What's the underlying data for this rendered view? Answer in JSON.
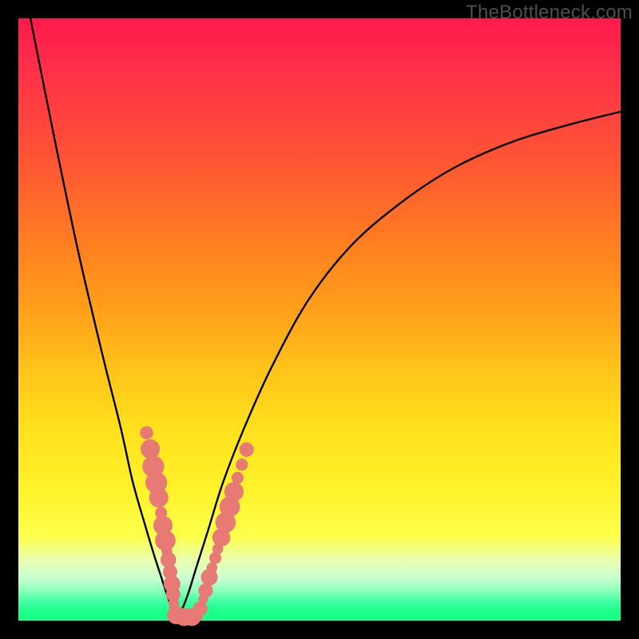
{
  "watermark": "TheBottleneck.com",
  "chart_data": {
    "type": "line",
    "title": "",
    "xlabel": "",
    "ylabel": "",
    "xlim": [
      0,
      100
    ],
    "ylim": [
      0,
      100
    ],
    "grid": false,
    "legend": false,
    "series": [
      {
        "name": "left-curve",
        "x": [
          2,
          6,
          10,
          14,
          17,
          19,
          21,
          22.5,
          23.8,
          24.6,
          25.2,
          25.6,
          25.9,
          26.1
        ],
        "y": [
          100,
          80,
          61,
          44,
          32,
          23,
          16,
          11,
          7,
          4.5,
          2.8,
          1.6,
          0.7,
          0.2
        ]
      },
      {
        "name": "right-curve",
        "x": [
          26.1,
          27,
          28.2,
          29.6,
          31.5,
          34,
          37.5,
          42,
          48,
          55,
          63,
          72,
          82,
          92,
          100
        ],
        "y": [
          0.2,
          1.5,
          4.5,
          9,
          15,
          23,
          32,
          42,
          53,
          62,
          69,
          75,
          79.5,
          82.5,
          84.5
        ]
      }
    ],
    "markers": {
      "name": "beads",
      "color": "#e77a74",
      "points": [
        {
          "x": 21.3,
          "y": 31.2,
          "r": 1.1
        },
        {
          "x": 21.9,
          "y": 28.5,
          "r": 1.6
        },
        {
          "x": 22.4,
          "y": 25.6,
          "r": 1.8
        },
        {
          "x": 22.9,
          "y": 22.9,
          "r": 1.8
        },
        {
          "x": 23.3,
          "y": 20.4,
          "r": 1.6
        },
        {
          "x": 23.7,
          "y": 17.9,
          "r": 1.0
        },
        {
          "x": 24.0,
          "y": 15.8,
          "r": 1.6
        },
        {
          "x": 24.4,
          "y": 13.3,
          "r": 1.7
        },
        {
          "x": 24.65,
          "y": 11.6,
          "r": 0.9
        },
        {
          "x": 24.9,
          "y": 10.1,
          "r": 1.3
        },
        {
          "x": 25.2,
          "y": 8.1,
          "r": 1.2
        },
        {
          "x": 25.5,
          "y": 6.1,
          "r": 1.4
        },
        {
          "x": 25.7,
          "y": 4.4,
          "r": 1.2
        },
        {
          "x": 25.8,
          "y": 2.9,
          "r": 0.9
        },
        {
          "x": 25.9,
          "y": 1.9,
          "r": 0.9
        },
        {
          "x": 26.2,
          "y": 0.9,
          "r": 1.5
        },
        {
          "x": 27.5,
          "y": 0.6,
          "r": 1.5
        },
        {
          "x": 28.8,
          "y": 0.6,
          "r": 1.5
        },
        {
          "x": 29.6,
          "y": 0.7,
          "r": 1.0
        },
        {
          "x": 30.2,
          "y": 2.0,
          "r": 1.2
        },
        {
          "x": 30.7,
          "y": 3.6,
          "r": 0.8
        },
        {
          "x": 31.1,
          "y": 5.0,
          "r": 1.2
        },
        {
          "x": 31.7,
          "y": 7.2,
          "r": 1.4
        },
        {
          "x": 32.15,
          "y": 8.8,
          "r": 0.9
        },
        {
          "x": 32.7,
          "y": 10.4,
          "r": 1.0
        },
        {
          "x": 33.1,
          "y": 11.9,
          "r": 0.9
        },
        {
          "x": 33.7,
          "y": 13.8,
          "r": 1.5
        },
        {
          "x": 34.4,
          "y": 16.3,
          "r": 1.7
        },
        {
          "x": 35.1,
          "y": 18.9,
          "r": 1.7
        },
        {
          "x": 35.8,
          "y": 21.4,
          "r": 1.6
        },
        {
          "x": 36.4,
          "y": 23.7,
          "r": 1.0
        },
        {
          "x": 37.1,
          "y": 25.9,
          "r": 1.0
        },
        {
          "x": 37.9,
          "y": 28.4,
          "r": 1.2
        }
      ]
    }
  }
}
